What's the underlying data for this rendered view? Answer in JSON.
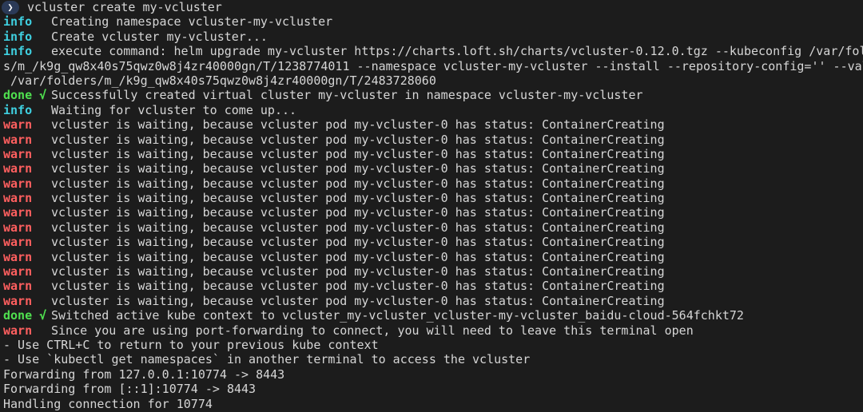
{
  "terminal": {
    "prompt_glyph": "❯",
    "command": "vcluster create my-vcluster",
    "lines": [
      {
        "level": "info",
        "text": "Creating namespace vcluster-my-vcluster"
      },
      {
        "level": "info",
        "text": "Create vcluster my-vcluster..."
      },
      {
        "level": "info",
        "text": "execute command: helm upgrade my-vcluster https://charts.loft.sh/charts/vcluster-0.12.0.tgz --kubeconfig /var/folder"
      },
      {
        "level": "",
        "text": "s/m_/k9g_qw8x40s75qwz0w8j4zr40000gn/T/1238774011 --namespace vcluster-my-vcluster --install --repository-config='' --values"
      },
      {
        "level": "",
        "text": " /var/folders/m_/k9g_qw8x40s75qwz0w8j4zr40000gn/T/2483728060"
      },
      {
        "level": "done √",
        "text": "Successfully created virtual cluster my-vcluster in namespace vcluster-my-vcluster"
      },
      {
        "level": "info",
        "text": "Waiting for vcluster to come up..."
      },
      {
        "level": "warn",
        "text": "vcluster is waiting, because vcluster pod my-vcluster-0 has status: ContainerCreating"
      },
      {
        "level": "warn",
        "text": "vcluster is waiting, because vcluster pod my-vcluster-0 has status: ContainerCreating"
      },
      {
        "level": "warn",
        "text": "vcluster is waiting, because vcluster pod my-vcluster-0 has status: ContainerCreating"
      },
      {
        "level": "warn",
        "text": "vcluster is waiting, because vcluster pod my-vcluster-0 has status: ContainerCreating"
      },
      {
        "level": "warn",
        "text": "vcluster is waiting, because vcluster pod my-vcluster-0 has status: ContainerCreating"
      },
      {
        "level": "warn",
        "text": "vcluster is waiting, because vcluster pod my-vcluster-0 has status: ContainerCreating"
      },
      {
        "level": "warn",
        "text": "vcluster is waiting, because vcluster pod my-vcluster-0 has status: ContainerCreating"
      },
      {
        "level": "warn",
        "text": "vcluster is waiting, because vcluster pod my-vcluster-0 has status: ContainerCreating"
      },
      {
        "level": "warn",
        "text": "vcluster is waiting, because vcluster pod my-vcluster-0 has status: ContainerCreating"
      },
      {
        "level": "warn",
        "text": "vcluster is waiting, because vcluster pod my-vcluster-0 has status: ContainerCreating"
      },
      {
        "level": "warn",
        "text": "vcluster is waiting, because vcluster pod my-vcluster-0 has status: ContainerCreating"
      },
      {
        "level": "warn",
        "text": "vcluster is waiting, because vcluster pod my-vcluster-0 has status: ContainerCreating"
      },
      {
        "level": "warn",
        "text": "vcluster is waiting, because vcluster pod my-vcluster-0 has status: ContainerCreating"
      },
      {
        "level": "done √",
        "text": "Switched active kube context to vcluster_my-vcluster_vcluster-my-vcluster_baidu-cloud-564fchkt72"
      },
      {
        "level": "warn",
        "text": "Since you are using port-forwarding to connect, you will need to leave this terminal open"
      },
      {
        "level": "",
        "text": "- Use CTRL+C to return to your previous kube context"
      },
      {
        "level": "",
        "text": "- Use `kubectl get namespaces` in another terminal to access the vcluster"
      },
      {
        "level": "",
        "text": "Forwarding from 127.0.0.1:10774 -> 8443"
      },
      {
        "level": "",
        "text": "Forwarding from [::1]:10774 -> 8443"
      },
      {
        "level": "",
        "text": "Handling connection for 10774"
      }
    ]
  },
  "colors": {
    "background": "#1c1c1c",
    "text": "#d6d6d6",
    "info": "#3fd0e0",
    "done": "#4fe04f",
    "warn": "#ff5f5f",
    "prompt_badge": "#2b3a57"
  }
}
